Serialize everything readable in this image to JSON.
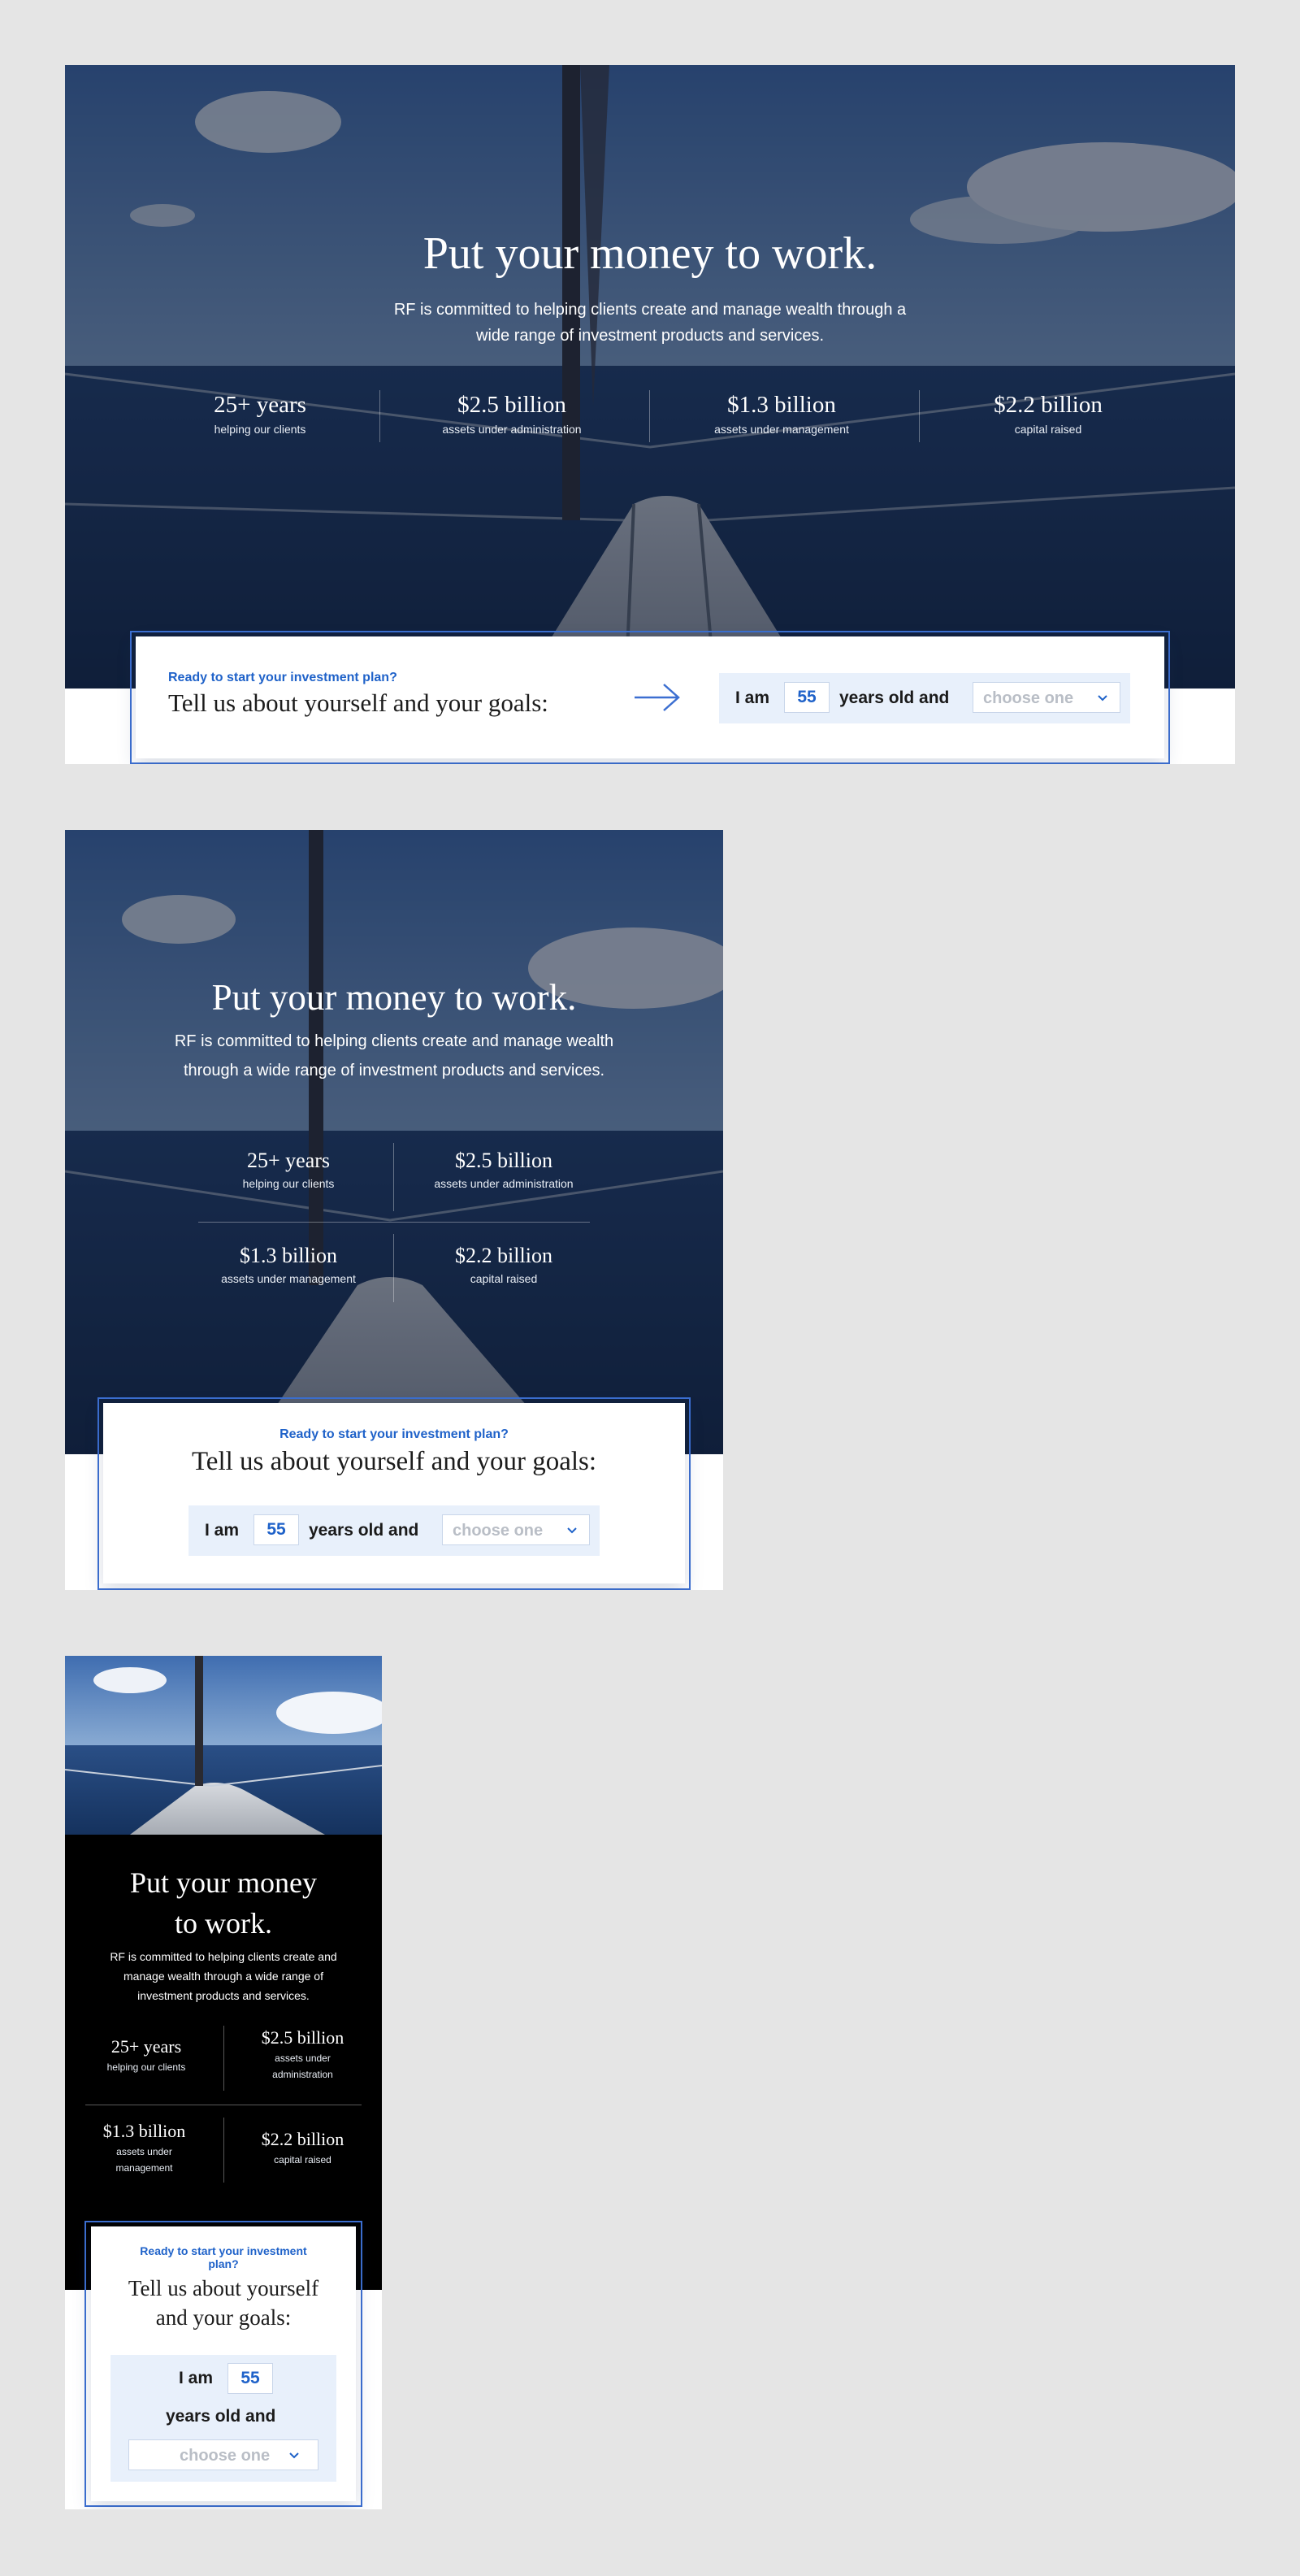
{
  "hero": {
    "title": "Put your money to work.",
    "description": "RF is committed to helping clients create and manage wealth through a wide range of investment products and services.",
    "stats": [
      {
        "value": "25+ years",
        "label": "helping our clients"
      },
      {
        "value": "$2.5 billion",
        "label": "assets under administration"
      },
      {
        "value": "$1.3 billion",
        "label": "assets under management"
      },
      {
        "value": "$2.2 billion",
        "label": "capital raised"
      }
    ]
  },
  "mobile": {
    "title_line1": "Put your money",
    "title_line2": "to work.",
    "desc_line1": "RF is committed to helping clients create and",
    "desc_line2": "manage wealth through a wide range of",
    "desc_line3": "investment products and services.",
    "stat2_label_l1": "assets under",
    "stat2_label_l2": "administration",
    "stat3_label_l1": "assets under",
    "stat3_label_l2": "management",
    "eyebrow_l1": "Ready to start your investment",
    "eyebrow_l2": "plan?",
    "card_title_l1": "Tell us about yourself",
    "card_title_l2": "and your goals:"
  },
  "tablet": {
    "desc_line1": "RF is committed to helping clients create and manage wealth",
    "desc_line2": "through a wide range of investment products and services."
  },
  "desktop": {
    "desc_line1": "RF is committed to helping clients create and manage wealth through a",
    "desc_line2": "wide range of investment products and services."
  },
  "cta": {
    "eyebrow": "Ready to start your investment plan?",
    "heading": "Tell us about yourself and your goals:",
    "prefix": "I am",
    "age_value": "55",
    "suffix": "years old and",
    "select_placeholder": "choose one"
  },
  "colors": {
    "accent": "#1f62c9",
    "card_outline": "#3c6fd1",
    "form_bg": "#e8f0fb",
    "mobile_bg": "#000000",
    "page_bg": "#e5e5e5"
  },
  "icons": [
    "arrow-right-icon",
    "chevron-down-icon"
  ]
}
